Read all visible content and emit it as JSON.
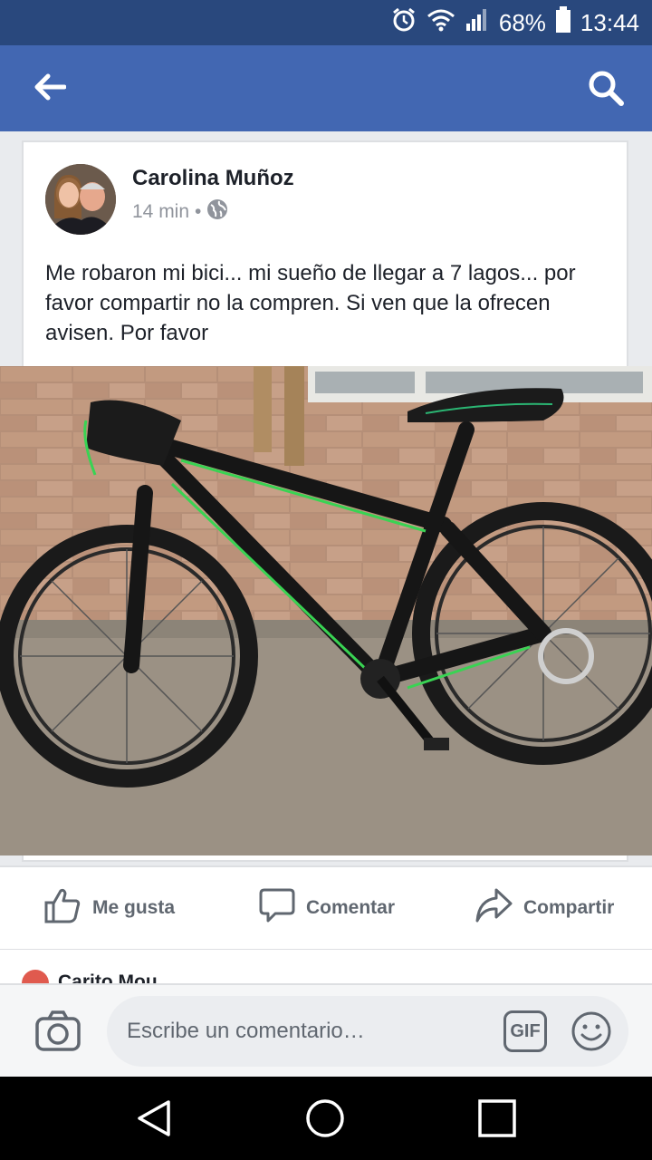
{
  "status_bar": {
    "icons": [
      "alarm-icon",
      "wifi-icon",
      "signal-icon",
      "battery-icon"
    ],
    "battery": "68%",
    "time": "13:44"
  },
  "app_bar": {
    "back_icon": "arrow-left-icon",
    "search_icon": "search-icon",
    "color": "#4267b2"
  },
  "post": {
    "author": "Carolina Muñoz",
    "time": "14 min",
    "separator": "•",
    "audience_icon": "globe-icon",
    "text": "Me robaron mi bici... mi sueño de llegar a 7 lagos... por favor compartir no la compren. Si ven que la ofrecen avisen. Por favor"
  },
  "actions": {
    "like": "Me gusta",
    "comment": "Comentar",
    "share": "Compartir"
  },
  "comment_preview": {
    "name": "Carito Mou"
  },
  "composer": {
    "placeholder": "Escribe un comentario…",
    "gif": "GIF"
  },
  "nav_bar": {
    "buttons": [
      "back-triangle-icon",
      "home-circle-icon",
      "recents-square-icon"
    ]
  }
}
